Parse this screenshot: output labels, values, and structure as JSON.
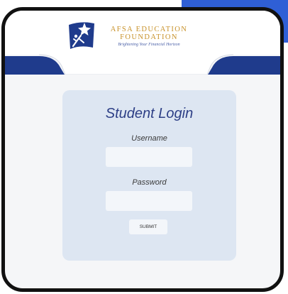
{
  "brand": {
    "logo_icon": "star-runner-logo-icon",
    "name_line1": "AFSA EDUCATION",
    "name_line2": "FOUNDATION",
    "tagline": "Brightening Your Financial Horizon"
  },
  "login": {
    "title": "Student Login",
    "username_label": "Username",
    "username_value": "",
    "username_placeholder": "",
    "password_label": "Password",
    "password_value": "",
    "password_placeholder": "",
    "submit_label": "SUBMIT"
  },
  "colors": {
    "corner_accent": "#2f5fd6",
    "header_navy": "#1f3b8c",
    "card_background": "#dde6f2",
    "title_blue": "#2d3f86",
    "logo_gold": "#c8922a"
  }
}
